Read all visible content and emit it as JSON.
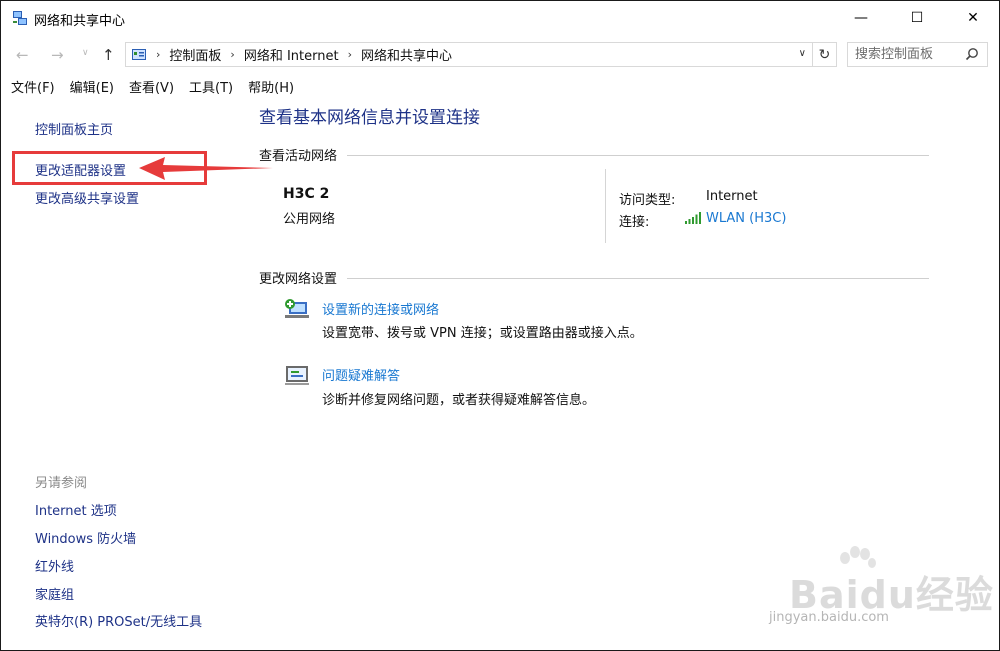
{
  "window": {
    "title": "网络和共享中心",
    "minimize_glyph": "—",
    "maximize_glyph": "☐",
    "close_glyph": "✕"
  },
  "nav": {
    "back_glyph": "←",
    "forward_glyph": "→",
    "history_glyph": "∨",
    "up_glyph": "↑",
    "refresh_glyph": "↻",
    "dropdown_glyph": "∨",
    "breadcrumb": [
      "控制面板",
      "网络和 Internet",
      "网络和共享中心"
    ],
    "separator": "›",
    "search_placeholder": "搜索控制面板"
  },
  "menu": [
    "文件(F)",
    "编辑(E)",
    "查看(V)",
    "工具(T)",
    "帮助(H)"
  ],
  "sidebar": {
    "links": [
      "控制面板主页",
      "更改适配器设置",
      "更改高级共享设置"
    ],
    "see_also_label": "另请参阅",
    "see_also": [
      "Internet 选项",
      "Windows 防火墙",
      "红外线",
      "家庭组",
      "英特尔(R) PROSet/无线工具"
    ]
  },
  "main": {
    "title": "查看基本网络信息并设置连接",
    "active_networks_header": "查看活动网络",
    "network": {
      "name": "H3C  2",
      "category": "公用网络",
      "access_type_label": "访问类型:",
      "access_type_value": "Internet",
      "connection_label": "连接:",
      "connection_value": "WLAN (H3C)"
    },
    "change_settings_header": "更改网络设置",
    "tasks": [
      {
        "title": "设置新的连接或网络",
        "description": "设置宽带、拨号或 VPN 连接；或设置路由器或接入点。",
        "icon": "new-connection-icon"
      },
      {
        "title": "问题疑难解答",
        "description": "诊断并修复网络问题，或者获得疑难解答信息。",
        "icon": "troubleshoot-icon"
      }
    ]
  },
  "watermark": {
    "text": "Baidu经验",
    "sub": "jingyan.baidu.com"
  },
  "colors": {
    "link_dark": "#1e3287",
    "link_blue": "#1978d1",
    "annotation_red": "#e63b3b"
  }
}
